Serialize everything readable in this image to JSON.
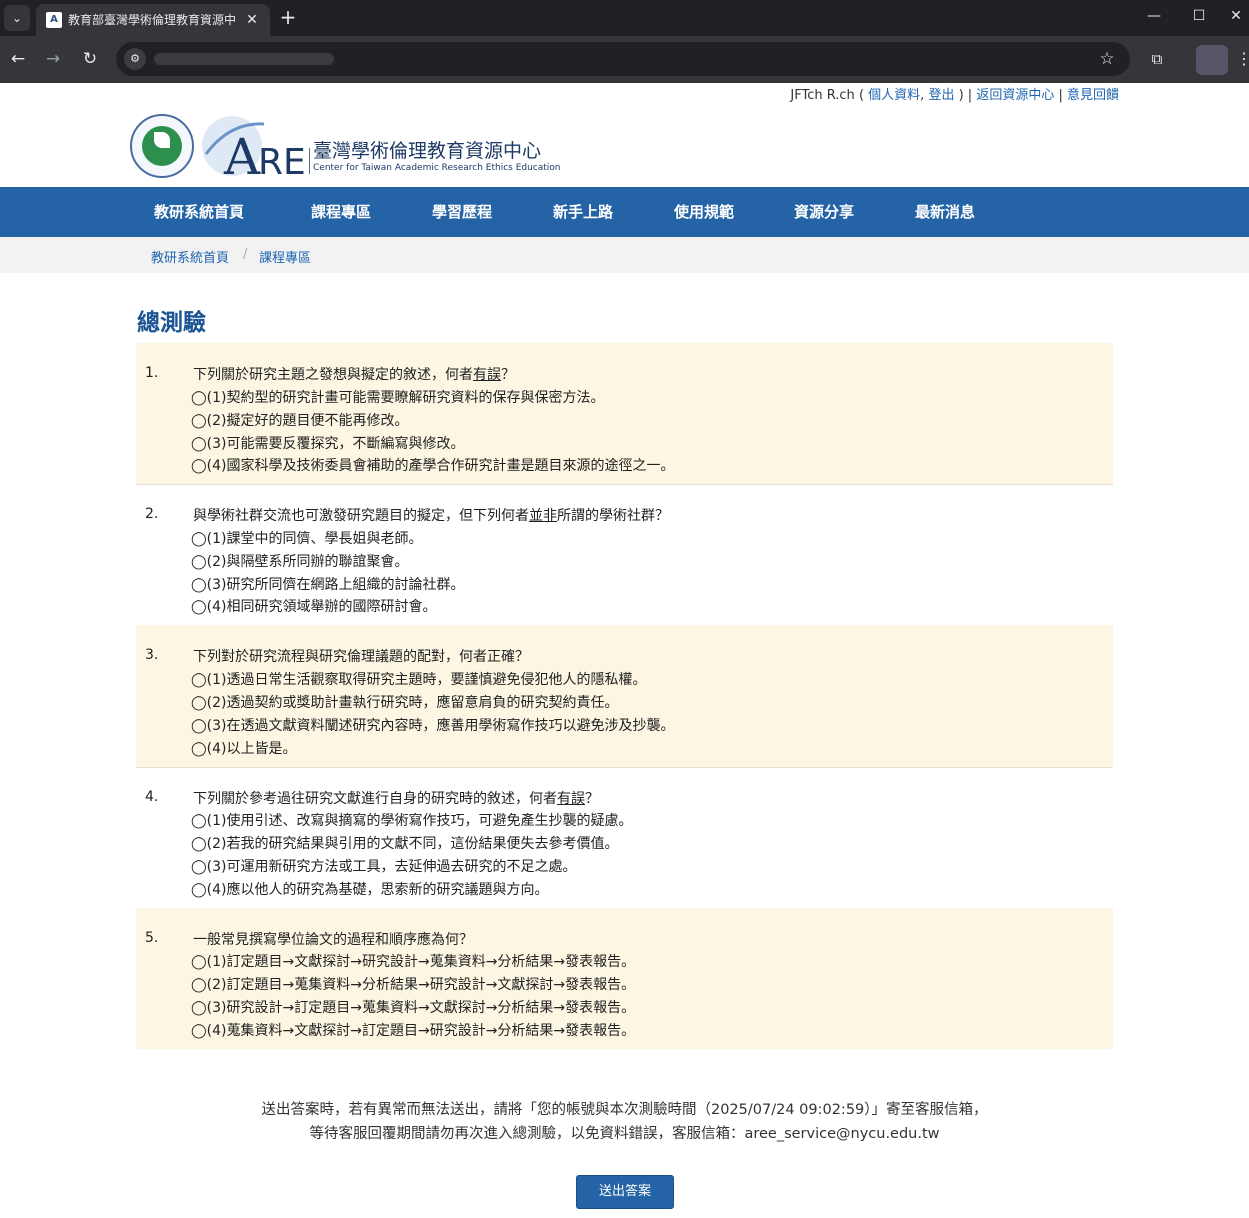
{
  "browser": {
    "tab_title": "教育部臺灣學術倫理教育資源中",
    "tab_favicon": "A"
  },
  "userbar": {
    "user_name": "JFTch R.ch",
    "open_paren": " ( ",
    "profile": "個人資料",
    "comma": ", ",
    "logout": "登出",
    "close_paren_sep": " ) | ",
    "back_center": "返回資源中心",
    "sep": " | ",
    "feedback": "意見回饋"
  },
  "logo": {
    "title": "臺灣學術倫理教育資源中心",
    "subtitle": "Center for Taiwan Academic Research Ethics Education"
  },
  "nav": {
    "items": [
      "教研系統首頁",
      "課程專區",
      "學習歷程",
      "新手上路",
      "使用規範",
      "資源分享",
      "最新消息"
    ]
  },
  "breadcrumb": {
    "items": [
      "教研系統首頁",
      "課程專區"
    ],
    "sep": "/"
  },
  "page_title": "總測驗",
  "questions": [
    {
      "num": "1.",
      "text_pre": "下列關於研究主題之發想與擬定的敘述，何者",
      "text_emph": "有誤",
      "text_post": "？",
      "options": [
        "◯(1)契約型的研究計畫可能需要瞭解研究資料的保存與保密方法。",
        "◯(2)擬定好的題目便不能再修改。",
        "◯(3)可能需要反覆探究，不斷編寫與修改。",
        "◯(4)國家科學及技術委員會補助的產學合作研究計畫是題目來源的途徑之一。"
      ]
    },
    {
      "num": "2.",
      "text_pre": "與學術社群交流也可激發研究題目的擬定，但下列何者",
      "text_emph": "並非",
      "text_post": "所謂的學術社群？",
      "options": [
        "◯(1)課堂中的同儕、學長姐與老師。",
        "◯(2)與隔壁系所同辦的聯誼聚會。",
        "◯(3)研究所同儕在網路上組織的討論社群。",
        "◯(4)相同研究領域舉辦的國際研討會。"
      ]
    },
    {
      "num": "3.",
      "text_pre": "下列對於研究流程與研究倫理議題的配對，何者正確？",
      "text_emph": "",
      "text_post": "",
      "options": [
        "◯(1)透過日常生活觀察取得研究主題時，要謹慎避免侵犯他人的隱私權。",
        "◯(2)透過契約或獎助計畫執行研究時，應留意肩負的研究契約責任。",
        "◯(3)在透過文獻資料闡述研究內容時，應善用學術寫作技巧以避免涉及抄襲。",
        "◯(4)以上皆是。"
      ]
    },
    {
      "num": "4.",
      "text_pre": "下列關於參考過往研究文獻進行自身的研究時的敘述，何者",
      "text_emph": "有誤",
      "text_post": "？",
      "options": [
        "◯(1)使用引述、改寫與摘寫的學術寫作技巧，可避免產生抄襲的疑慮。",
        "◯(2)若我的研究結果與引用的文獻不同，這份結果便失去參考價值。",
        "◯(3)可運用新研究方法或工具，去延伸過去研究的不足之處。",
        "◯(4)應以他人的研究為基礎，思索新的研究議題與方向。"
      ]
    },
    {
      "num": "5.",
      "text_pre": "一般常見撰寫學位論文的過程和順序應為何？",
      "text_emph": "",
      "text_post": "",
      "options": [
        "◯(1)訂定題目→文獻探討→研究設計→蒐集資料→分析結果→發表報告。",
        "◯(2)訂定題目→蒐集資料→分析結果→研究設計→文獻探討→發表報告。",
        "◯(3)研究設計→訂定題目→蒐集資料→文獻探討→分析結果→發表報告。",
        "◯(4)蒐集資料→文獻探討→訂定題目→研究設計→分析結果→發表報告。"
      ]
    }
  ],
  "notice": {
    "line1": "送出答案時，若有異常而無法送出，請將「您的帳號與本次測驗時間（2025/07/24 09:02:59）」寄至客服信箱，",
    "line2": "等待客服回覆期間請勿再次進入總測驗，以免資料錯誤，客服信箱：aree_service@nycu.edu.tw"
  },
  "submit_label": "送出答案",
  "colors": {
    "nav_bg": "#2463a6",
    "link": "#1f64b0",
    "shaded_row": "#fcf6e3",
    "title": "#1d5493"
  },
  "icons": [
    "tab-search-icon",
    "close-icon",
    "plus-icon",
    "minimize-icon",
    "maximize-icon",
    "close-window-icon",
    "back-icon",
    "forward-icon",
    "reload-icon",
    "site-info-icon",
    "star-icon",
    "extensions-icon",
    "menu-icon"
  ]
}
